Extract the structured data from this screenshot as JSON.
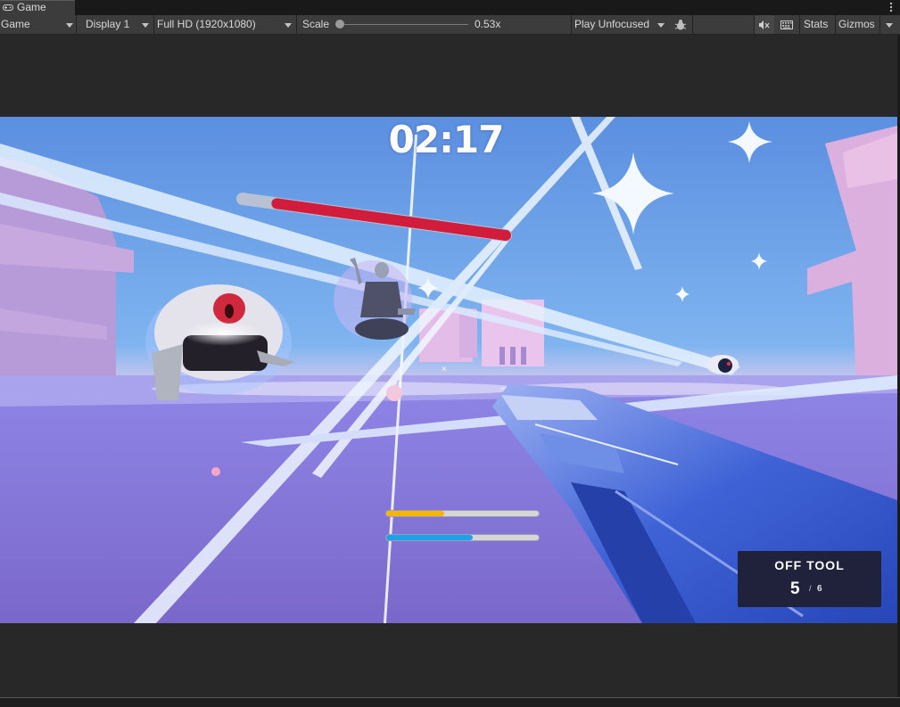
{
  "window": {
    "tab_title": "Game",
    "tab_icon": "gamepad-icon",
    "menu_icon": "kebab-menu-icon"
  },
  "toolbar": {
    "mode_label": "Game",
    "display_label": "Display 1",
    "resolution_label": "Full HD (1920x1080)",
    "scale_label": "Scale",
    "scale_value": "0.53x",
    "scale_fraction": 0.0,
    "play_mode_label": "Play Unfocused",
    "stats_label": "Stats",
    "gizmos_label": "Gizmos",
    "icons": {
      "debug": "bug-icon",
      "mute": "mute-audio-icon",
      "shortcuts": "keyboard-icon"
    }
  },
  "game": {
    "timer": "02:17",
    "crosshair": "×",
    "enemy_health_fraction": 0.87,
    "stamina_fraction": 0.38,
    "energy_fraction": 0.57,
    "ammo": {
      "title": "OFF TOOL",
      "current": "5",
      "slash": "/",
      "max": "6"
    },
    "colors": {
      "health": "#d21c3c",
      "stamina": "#f7b500",
      "energy": "#1aa3ea",
      "ammo_panel": "#20223c"
    }
  }
}
